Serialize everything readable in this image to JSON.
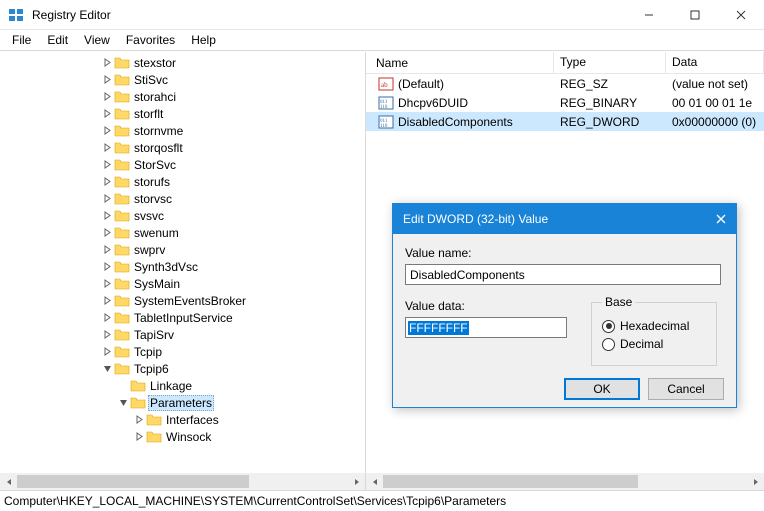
{
  "app": {
    "title": "Registry Editor"
  },
  "menu": {
    "file": "File",
    "edit": "Edit",
    "view": "View",
    "favorites": "Favorites",
    "help": "Help"
  },
  "tree": {
    "items": [
      {
        "label": "stexstor",
        "depth": 6,
        "twisty": "right"
      },
      {
        "label": "StiSvc",
        "depth": 6,
        "twisty": "right"
      },
      {
        "label": "storahci",
        "depth": 6,
        "twisty": "right"
      },
      {
        "label": "storflt",
        "depth": 6,
        "twisty": "right"
      },
      {
        "label": "stornvme",
        "depth": 6,
        "twisty": "right"
      },
      {
        "label": "storqosflt",
        "depth": 6,
        "twisty": "right"
      },
      {
        "label": "StorSvc",
        "depth": 6,
        "twisty": "right"
      },
      {
        "label": "storufs",
        "depth": 6,
        "twisty": "right"
      },
      {
        "label": "storvsc",
        "depth": 6,
        "twisty": "right"
      },
      {
        "label": "svsvc",
        "depth": 6,
        "twisty": "right"
      },
      {
        "label": "swenum",
        "depth": 6,
        "twisty": "right"
      },
      {
        "label": "swprv",
        "depth": 6,
        "twisty": "right"
      },
      {
        "label": "Synth3dVsc",
        "depth": 6,
        "twisty": "right"
      },
      {
        "label": "SysMain",
        "depth": 6,
        "twisty": "right"
      },
      {
        "label": "SystemEventsBroker",
        "depth": 6,
        "twisty": "right"
      },
      {
        "label": "TabletInputService",
        "depth": 6,
        "twisty": "right"
      },
      {
        "label": "TapiSrv",
        "depth": 6,
        "twisty": "right"
      },
      {
        "label": "Tcpip",
        "depth": 6,
        "twisty": "right"
      },
      {
        "label": "Tcpip6",
        "depth": 6,
        "twisty": "down"
      },
      {
        "label": "Linkage",
        "depth": 7,
        "twisty": "none"
      },
      {
        "label": "Parameters",
        "depth": 7,
        "twisty": "down",
        "selected": true
      },
      {
        "label": "Interfaces",
        "depth": 8,
        "twisty": "right"
      },
      {
        "label": "Winsock",
        "depth": 8,
        "twisty": "right"
      }
    ]
  },
  "list": {
    "headers": {
      "name": "Name",
      "type": "Type",
      "data": "Data"
    },
    "rows": [
      {
        "icon": "sz",
        "name": "(Default)",
        "type": "REG_SZ",
        "data": "(value not set)"
      },
      {
        "icon": "bin",
        "name": "Dhcpv6DUID",
        "type": "REG_BINARY",
        "data": "00 01 00 01 1e"
      },
      {
        "icon": "bin",
        "name": "DisabledComponents",
        "type": "REG_DWORD",
        "data": "0x00000000 (0)",
        "selected": true
      }
    ]
  },
  "statusbar": {
    "path": "Computer\\HKEY_LOCAL_MACHINE\\SYSTEM\\CurrentControlSet\\Services\\Tcpip6\\Parameters"
  },
  "dialog": {
    "title": "Edit DWORD (32-bit) Value",
    "valueNameLabel": "Value name:",
    "valueName": "DisabledComponents",
    "valueDataLabel": "Value data:",
    "valueData": "FFFFFFFF",
    "baseLabel": "Base",
    "hex": "Hexadecimal",
    "dec": "Decimal",
    "ok": "OK",
    "cancel": "Cancel"
  }
}
